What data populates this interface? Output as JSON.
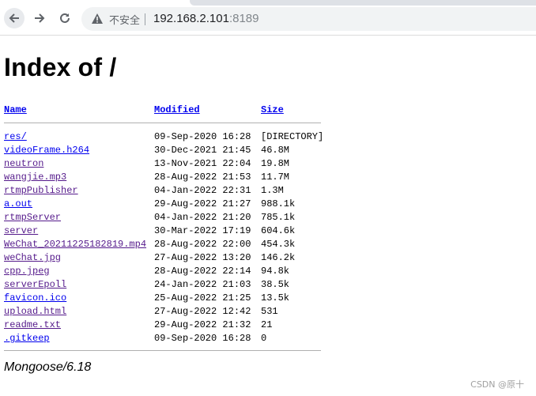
{
  "browser": {
    "security_label": "不安全",
    "url_host": "192.168.2.101",
    "url_port": ":8189"
  },
  "page": {
    "title": "Index of /",
    "columns": {
      "name": "Name",
      "modified": "Modified",
      "size": "Size"
    },
    "entries": [
      {
        "name": "res/",
        "modified": "09-Sep-2020 16:28",
        "size": "[DIRECTORY]"
      },
      {
        "name": "videoFrame.h264",
        "modified": "30-Dec-2021 21:45",
        "size": "46.8M"
      },
      {
        "name": "neutron",
        "modified": "13-Nov-2021 22:04",
        "size": "19.8M"
      },
      {
        "name": "wangjie.mp3",
        "modified": "28-Aug-2022 21:53",
        "size": "11.7M"
      },
      {
        "name": "rtmpPublisher",
        "modified": "04-Jan-2022 22:31",
        "size": "1.3M"
      },
      {
        "name": "a.out",
        "modified": "29-Aug-2022 21:27",
        "size": "988.1k"
      },
      {
        "name": "rtmpServer",
        "modified": "04-Jan-2022 21:20",
        "size": "785.1k"
      },
      {
        "name": "server",
        "modified": "30-Mar-2022 17:19",
        "size": "604.6k"
      },
      {
        "name": "WeChat_20211225182819.mp4",
        "modified": "28-Aug-2022 22:00",
        "size": "454.3k"
      },
      {
        "name": "weChat.jpg",
        "modified": "27-Aug-2022 13:20",
        "size": "146.2k"
      },
      {
        "name": "cpp.jpeg",
        "modified": "28-Aug-2022 22:14",
        "size": "94.8k"
      },
      {
        "name": "serverEpoll",
        "modified": "24-Jan-2022 21:03",
        "size": "38.5k"
      },
      {
        "name": "favicon.ico",
        "modified": "25-Aug-2022 21:25",
        "size": "13.5k"
      },
      {
        "name": "upload.html",
        "modified": "27-Aug-2022 12:42",
        "size": "531"
      },
      {
        "name": "readme.txt",
        "modified": "29-Aug-2022 21:32",
        "size": "21"
      },
      {
        "name": ".gitkeep",
        "modified": "09-Sep-2020 16:28",
        "size": "0"
      }
    ],
    "visited_indexes": [
      2,
      3,
      4,
      6,
      7,
      8,
      9,
      10,
      11,
      13,
      14
    ],
    "server_signature": "Mongoose/6.18"
  },
  "watermark": "CSDN @原十",
  "colors": {
    "link": "#0000ee",
    "visited_link": "#551a8b"
  }
}
